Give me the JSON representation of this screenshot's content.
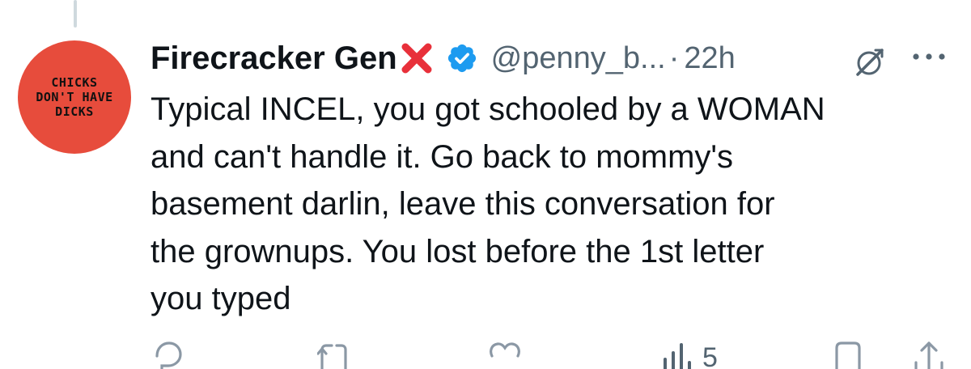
{
  "post": {
    "avatar_text": "CHICKS\nDON'T HAVE\nDICKS",
    "display_name": "Firecracker Gen",
    "name_emoji": "cross-mark-emoji",
    "handle": "@penny_b...",
    "separator": "·",
    "time": "22h",
    "text": "Typical INCEL, you got schooled by a WOMAN\nand can't handle it. Go back to mommy's\nbasement darlin, leave this conversation for\nthe grownups. You lost before the 1st letter\nyou typed",
    "views": "5"
  },
  "icons": {
    "verified": "verified-badge-icon",
    "grok": "grok-icon",
    "more": "more-icon",
    "reply": "reply-icon",
    "retweet": "retweet-icon",
    "like": "like-icon",
    "views": "views-icon",
    "bookmark": "bookmark-icon",
    "share": "share-icon"
  },
  "colors": {
    "avatar_bg": "#e74c3c",
    "verified_blue": "#1d9bf0",
    "secondary_text": "#536471",
    "primary_text": "#0f1419",
    "cross_red": "#e8303a",
    "thread_line": "#cfd9de"
  }
}
